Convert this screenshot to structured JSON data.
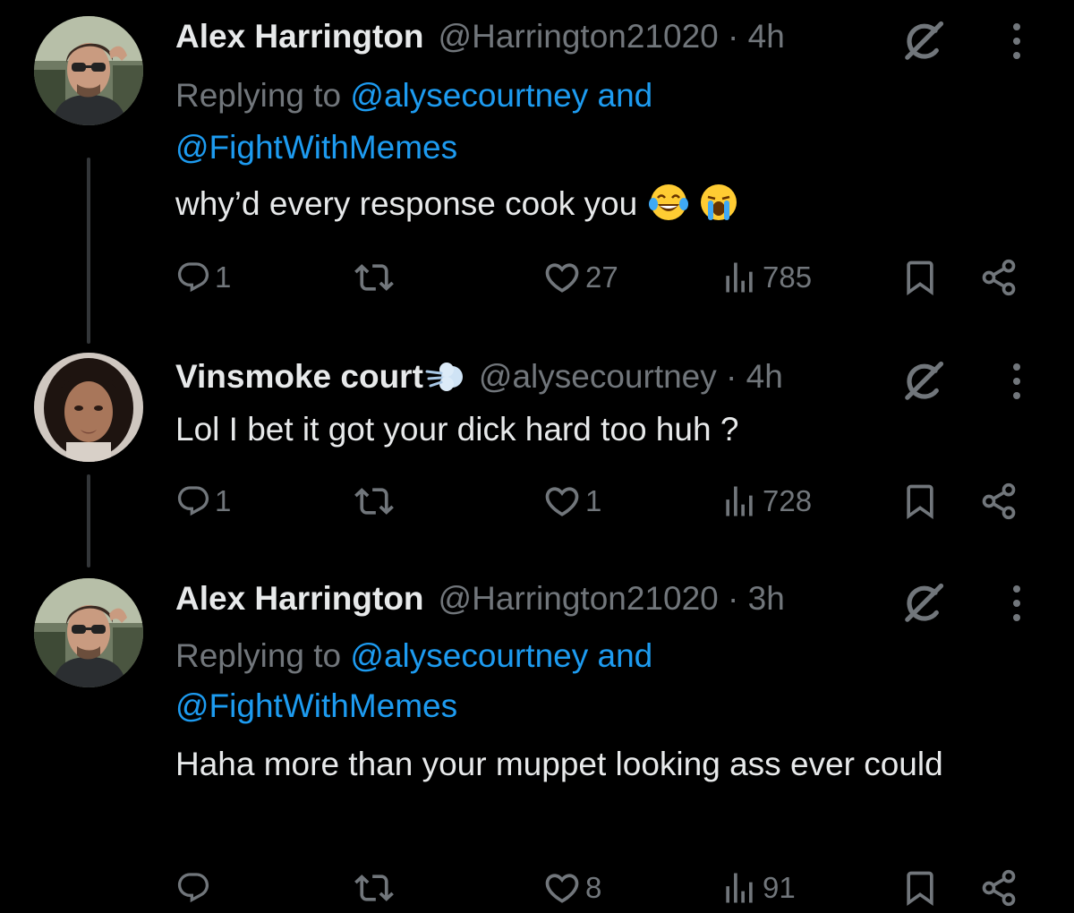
{
  "tweets": [
    {
      "name": "Alex Harrington",
      "handle": "@Harrington21020",
      "separator": "·",
      "time": "4h",
      "replying_prefix": "Replying to",
      "replying_user1": "@alysecourtney",
      "replying_joiner": "and",
      "replying_user2": "@FightWithMemes",
      "text": "why’d every response cook you",
      "emojis": [
        "tears-of-joy-emoji",
        "loudly-crying-emoji"
      ],
      "replies": "1",
      "reposts": "",
      "likes": "27",
      "views": "785"
    },
    {
      "name": "Vinsmoke court",
      "name_badge": "dash-away-emoji",
      "handle": "@alysecourtney",
      "separator": "·",
      "time": "4h",
      "text": "Lol I bet it got your dick hard too huh ?",
      "replies": "1",
      "reposts": "",
      "likes": "1",
      "views": "728"
    },
    {
      "name": "Alex Harrington",
      "handle": "@Harrington21020",
      "separator": "·",
      "time": "3h",
      "replying_prefix": "Replying to",
      "replying_user1": "@alysecourtney",
      "replying_joiner": "and",
      "replying_user2": "@FightWithMemes",
      "text": "Haha more than your muppet looking ass ever could",
      "replies": "",
      "reposts": "",
      "likes": "8",
      "views": "91"
    }
  ],
  "icons": {
    "reply": "reply-icon",
    "repost": "repost-icon",
    "like": "heart-icon",
    "views": "views-icon",
    "bookmark": "bookmark-icon",
    "share": "share-icon",
    "grok": "grok-icon",
    "more": "more-icon"
  },
  "colors": {
    "background": "#000000",
    "primary_text": "#e7e9ea",
    "secondary_text": "#71767b",
    "link": "#1d9bf0",
    "thread_line": "#333639"
  }
}
